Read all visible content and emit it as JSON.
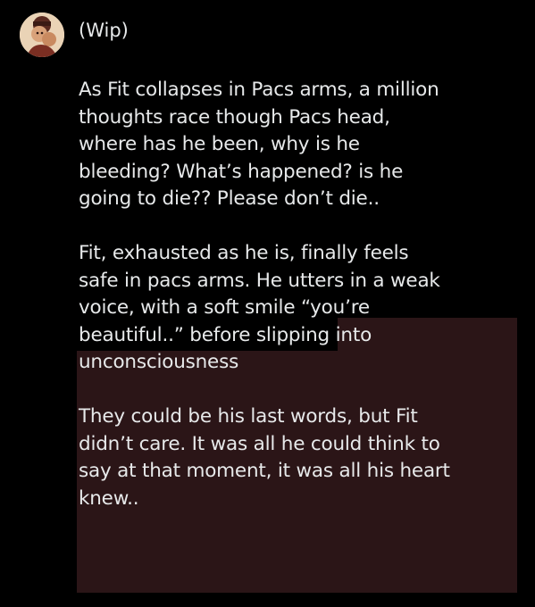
{
  "post": {
    "header": "(Wip)",
    "avatar_icon": "character-avatar",
    "highlight_color": "#2b1517",
    "paragraphs": [
      "As Fit collapses in Pacs arms, a million\nthoughts race though Pacs head,\nwhere has he been, why is he\nbleeding? What’s happened? is he\ngoing to die?? Please don’t die..",
      "Fit, exhausted as he is, finally feels\nsafe in pacs arms. He utters in a weak\nvoice, with a soft smile “you’re\nbeautiful..” before slipping into\nunconsciousness",
      "They could be his last words, but Fit\ndidn’t care. It was all he could think to\nsay at that moment, it was all his heart\nknew.."
    ]
  }
}
